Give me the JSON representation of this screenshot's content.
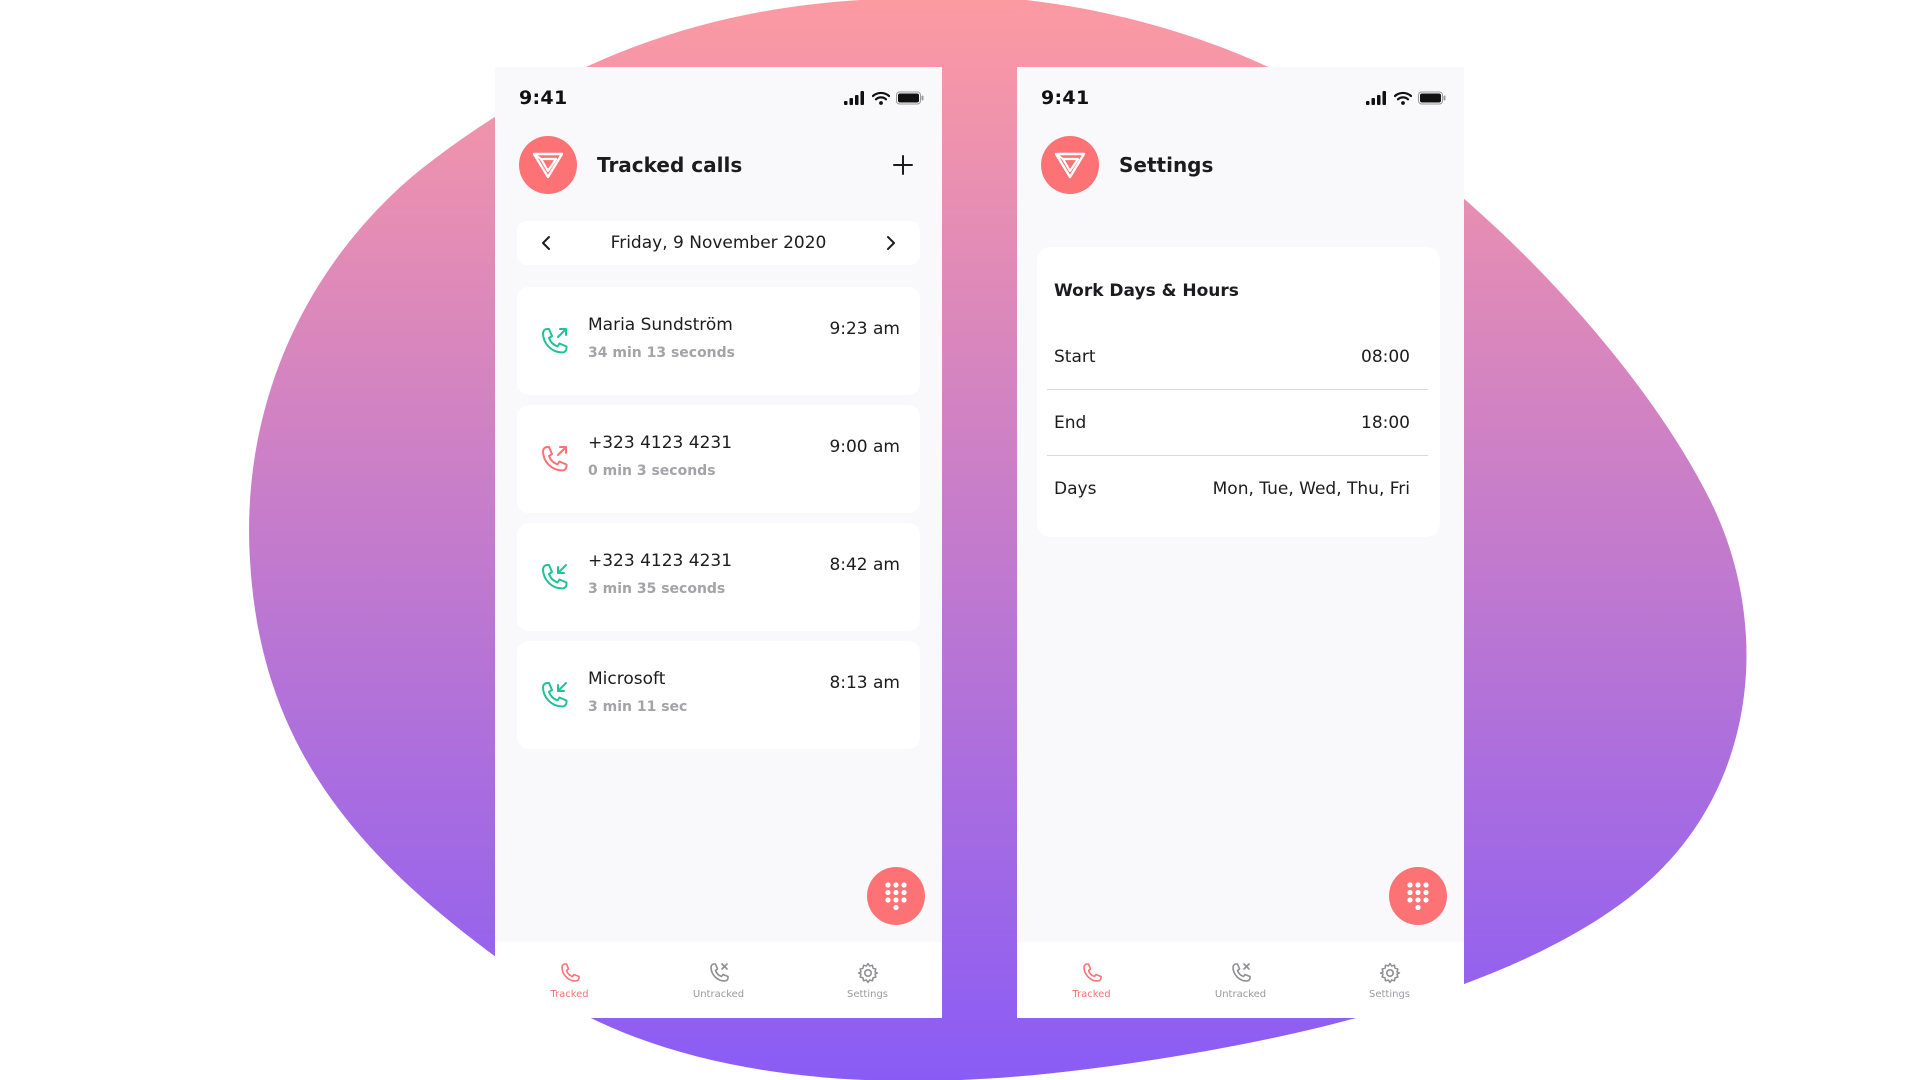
{
  "colors": {
    "accent": "#fc7275",
    "blob_top": "#fd9aa2",
    "blob_bottom": "#8a5cf6",
    "incoming_green": "#1fc29a",
    "missed_red": "#fc7275"
  },
  "status_bar": {
    "time": "9:41"
  },
  "tracked_screen": {
    "title": "Tracked calls",
    "date": "Friday, 9 November 2020",
    "calls": [
      {
        "name": "Maria Sundström",
        "duration": "34 min 13 seconds",
        "time": "9:23 am",
        "icon": "outgoing-call-icon",
        "color": "#1fc29a"
      },
      {
        "name": "+323 4123 4231",
        "duration": "0 min 3 seconds",
        "time": "9:00 am",
        "icon": "outgoing-call-icon",
        "color": "#fc7275"
      },
      {
        "name": "+323 4123 4231",
        "duration": "3 min 35 seconds",
        "time": "8:42 am",
        "icon": "incoming-call-icon",
        "color": "#1fc29a"
      },
      {
        "name": "Microsoft",
        "duration": "3 min 11 sec",
        "time": "8:13 am",
        "icon": "incoming-call-icon",
        "color": "#1fc29a"
      }
    ]
  },
  "settings_screen": {
    "title": "Settings",
    "section_title": "Work Days & Hours",
    "rows": [
      {
        "label": "Start",
        "value": "08:00"
      },
      {
        "label": "End",
        "value": "18:00"
      },
      {
        "label": "Days",
        "value": "Mon, Tue, Wed, Thu, Fri"
      }
    ]
  },
  "tabs": [
    {
      "label": "Tracked",
      "icon": "phone-icon",
      "active": true
    },
    {
      "label": "Untracked",
      "icon": "phone-missed-icon",
      "active": false
    },
    {
      "label": "Settings",
      "icon": "gear-icon",
      "active": false
    }
  ]
}
